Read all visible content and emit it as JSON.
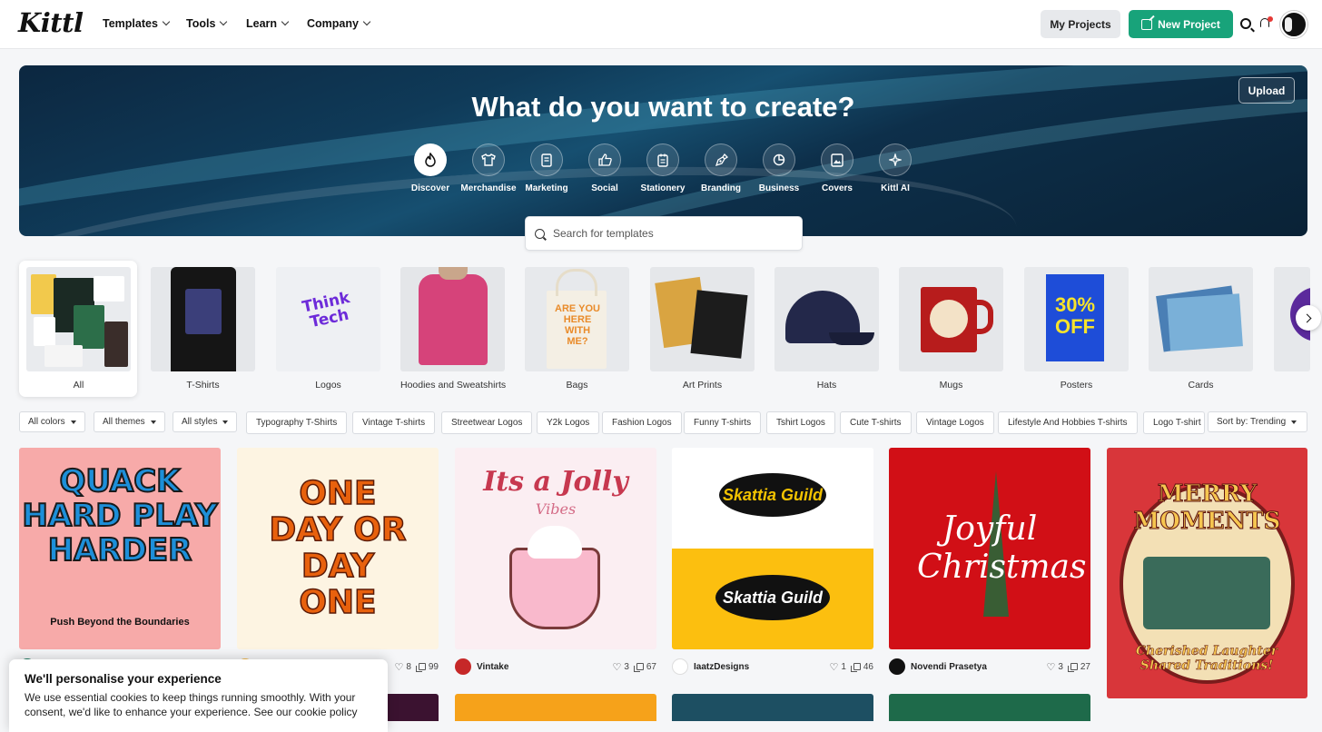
{
  "nav": {
    "logo": "Kittl",
    "menu": [
      {
        "label": "Templates"
      },
      {
        "label": "Tools"
      },
      {
        "label": "Learn"
      },
      {
        "label": "Company"
      }
    ],
    "my_projects": "My Projects",
    "new_project": "New Project"
  },
  "hero": {
    "title": "What do you want to create?",
    "upload": "Upload",
    "categories": [
      {
        "label": "Discover",
        "icon": "flame-icon",
        "active": true
      },
      {
        "label": "Merchandise",
        "icon": "shirt-icon"
      },
      {
        "label": "Marketing",
        "icon": "flyer-icon"
      },
      {
        "label": "Social",
        "icon": "thumbs-up-icon"
      },
      {
        "label": "Stationery",
        "icon": "notepad-icon"
      },
      {
        "label": "Branding",
        "icon": "pen-tool-icon"
      },
      {
        "label": "Business",
        "icon": "pie-chart-icon"
      },
      {
        "label": "Covers",
        "icon": "image-frame-icon"
      },
      {
        "label": "Kittl AI",
        "icon": "sparkle-icon"
      }
    ],
    "search_placeholder": "Search for templates"
  },
  "product_types": [
    {
      "label": "All"
    },
    {
      "label": "T-Shirts"
    },
    {
      "label": "Logos"
    },
    {
      "label": "Hoodies and Sweatshirts"
    },
    {
      "label": "Bags"
    },
    {
      "label": "Art Prints"
    },
    {
      "label": "Hats"
    },
    {
      "label": "Mugs"
    },
    {
      "label": "Posters"
    },
    {
      "label": "Cards"
    }
  ],
  "filters": {
    "colors": "All colors",
    "themes": "All themes",
    "styles": "All styles",
    "tags": [
      "Typography T-Shirts",
      "Vintage T-shirts",
      "Streetwear Logos",
      "Y2k Logos",
      "Fashion Logos",
      "Funny T-shirts",
      "Tshirt Logos",
      "Cute T-shirts",
      "Vintage Logos",
      "Lifestyle And Hobbies T-shirts",
      "Logo T-shirt"
    ],
    "sort": "Sort by: Trending"
  },
  "templates": [
    {
      "art_text": "QUACK HARD PLAY HARDER",
      "art_sub": "Push Beyond the Boundaries",
      "bg": "#f7aaa9",
      "author": "",
      "likes": "",
      "uses": ""
    },
    {
      "art_text": "ONE DAY OR DAY ONE",
      "art_sub": "",
      "bg": "#fdf4e2",
      "author": "",
      "likes": "8",
      "uses": "99"
    },
    {
      "art_text": "Its a Jolly",
      "art_sub": "Vibes",
      "bg": "#fbeef2",
      "author": "Vintake",
      "likes": "3",
      "uses": "67"
    },
    {
      "art_text": "Skattia Guild",
      "art_sub": "Skattia Guild",
      "bg": "#ffffff",
      "author": "IaatzDesigns",
      "likes": "1",
      "uses": "46"
    },
    {
      "art_text": "Joyful Christmas",
      "art_sub": "",
      "bg": "#d10f16",
      "author": "Novendi Prasetya",
      "likes": "3",
      "uses": "27"
    },
    {
      "art_text": "MERRY MOMENTS",
      "art_sub": "Cherished Laughter Shared Traditions!",
      "bg": "#d8363a",
      "author": "",
      "likes": "",
      "uses": ""
    }
  ],
  "cookie": {
    "title": "We'll personalise your experience",
    "text": "We use essential cookies to keep things running smoothly. With your consent, we'd like to enhance your experience. See our cookie policy"
  }
}
